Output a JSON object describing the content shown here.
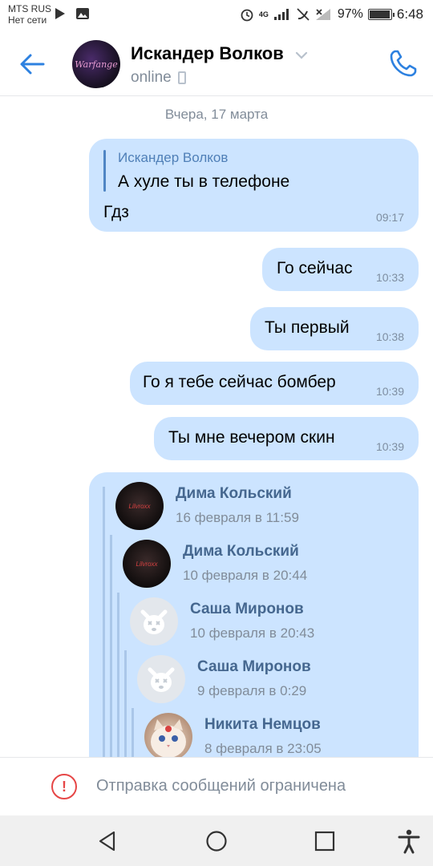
{
  "status_bar": {
    "carrier": "MTS RUS",
    "carrier_status": "Нет сети",
    "network": "4G",
    "battery": "97%",
    "battery_level": 0.97,
    "time": "6:48"
  },
  "header": {
    "contact_name": "Искандер Волков",
    "contact_status": "online",
    "avatar_text": "Warfange"
  },
  "chat": {
    "date_separator": "Вчера, 17 марта",
    "messages": [
      {
        "reply_author": "Искандер Волков",
        "reply_text": "А хуле ты в телефоне",
        "text": "Гдз",
        "time": "09:17"
      },
      {
        "text": "Го сейчас",
        "time": "10:33"
      },
      {
        "text": "Ты первый",
        "time": "10:38"
      },
      {
        "text": "Го я тебе сейчас бомбер",
        "time": "10:39"
      },
      {
        "text": "Ты мне вечером скин",
        "time": "10:39"
      }
    ],
    "forwarded": [
      {
        "name": "Дима Кольский",
        "date": "16 февраля в 11:59",
        "avatar": "dark",
        "avatar_text": "Lilvroxx"
      },
      {
        "name": "Дима Кольский",
        "date": "10 февраля в 20:44",
        "avatar": "dark",
        "avatar_text": "Lilvroxx"
      },
      {
        "name": "Саша Миронов",
        "date": "10 февраля в 20:43",
        "avatar": "dog"
      },
      {
        "name": "Саша Миронов",
        "date": "9 февраля в 0:29",
        "avatar": "dog"
      },
      {
        "name": "Никита Немцов",
        "date": "8 февраля в 23:05",
        "avatar": "cat"
      }
    ]
  },
  "footer": {
    "restricted_icon": "!",
    "restricted_text": "Отправка сообщений ограничена"
  },
  "navbar": {
    "buttons": [
      "back-icon",
      "home-icon",
      "recents-icon",
      "accessibility-icon"
    ]
  },
  "colors": {
    "accent": "#2d81e0",
    "bubble": "#cce4ff",
    "warning": "#e64646",
    "secondary_text": "#818c99"
  }
}
